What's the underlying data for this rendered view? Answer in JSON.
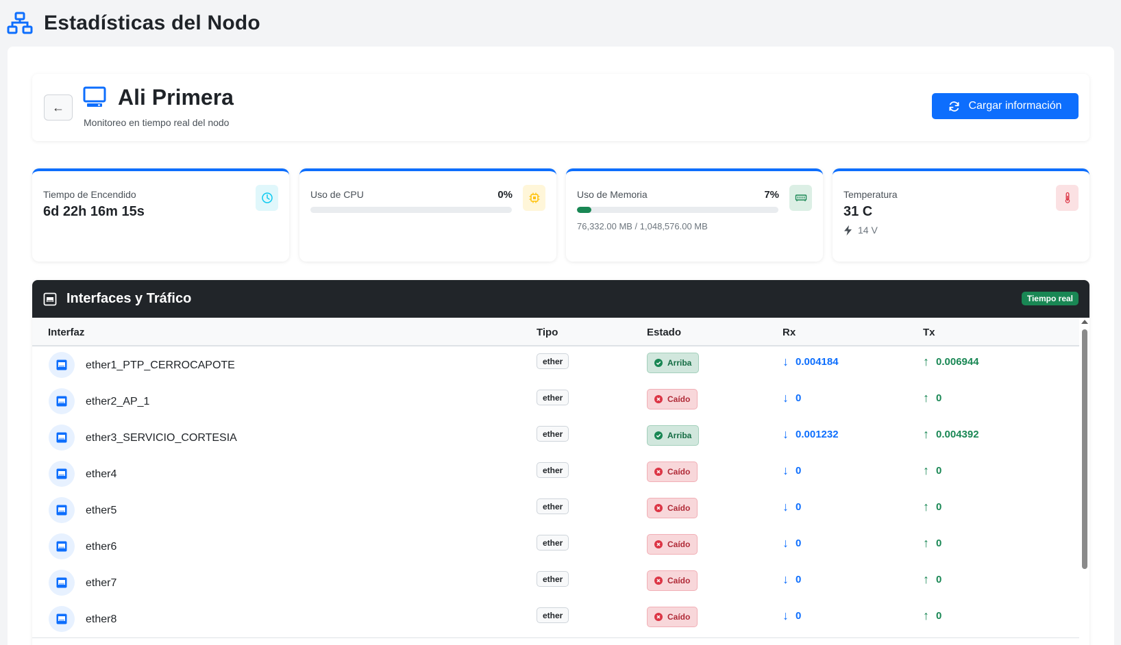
{
  "page": {
    "title": "Estadísticas del Nodo"
  },
  "node": {
    "name": "Ali Primera",
    "subtitle": "Monitoreo en tiempo real del nodo",
    "back_label": "←",
    "load_button_label": "Cargar información"
  },
  "stats": {
    "uptime": {
      "label": "Tiempo de Encendido",
      "value": "6d 22h 16m 15s",
      "icon": "clock-icon"
    },
    "cpu": {
      "label": "Uso de CPU",
      "percent_text": "0%",
      "percent": 0,
      "icon": "cpu-icon"
    },
    "memory": {
      "label": "Uso de Memoria",
      "percent_text": "7%",
      "percent": 7,
      "detail": "76,332.00 MB / 1,048,576.00 MB",
      "icon": "memory-icon"
    },
    "temperature": {
      "label": "Temperatura",
      "value": "31 C",
      "voltage": "14 V",
      "icon": "thermometer-icon"
    }
  },
  "interfaces": {
    "title": "Interfaces y Tráfico",
    "badge": "Tiempo real",
    "columns": {
      "interface": "Interfaz",
      "type": "Tipo",
      "state": "Estado",
      "rx": "Rx",
      "tx": "Tx"
    },
    "rows": [
      {
        "name": "ether1_PTP_CERROCAPOTE",
        "type": "ether",
        "state": "Arriba",
        "up": true,
        "rx": "0.004184",
        "tx": "0.006944"
      },
      {
        "name": "ether2_AP_1",
        "type": "ether",
        "state": "Caído",
        "up": false,
        "rx": "0",
        "tx": "0"
      },
      {
        "name": "ether3_SERVICIO_CORTESIA",
        "type": "ether",
        "state": "Arriba",
        "up": true,
        "rx": "0.001232",
        "tx": "0.004392"
      },
      {
        "name": "ether4",
        "type": "ether",
        "state": "Caído",
        "up": false,
        "rx": "0",
        "tx": "0"
      },
      {
        "name": "ether5",
        "type": "ether",
        "state": "Caído",
        "up": false,
        "rx": "0",
        "tx": "0"
      },
      {
        "name": "ether6",
        "type": "ether",
        "state": "Caído",
        "up": false,
        "rx": "0",
        "tx": "0"
      },
      {
        "name": "ether7",
        "type": "ether",
        "state": "Caído",
        "up": false,
        "rx": "0",
        "tx": "0"
      },
      {
        "name": "ether8",
        "type": "ether",
        "state": "Caído",
        "up": false,
        "rx": "0",
        "tx": "0"
      }
    ]
  },
  "colors": {
    "primary": "#0d6efd",
    "success": "#198754",
    "danger": "#dc3545",
    "dark_header": "#212529"
  }
}
